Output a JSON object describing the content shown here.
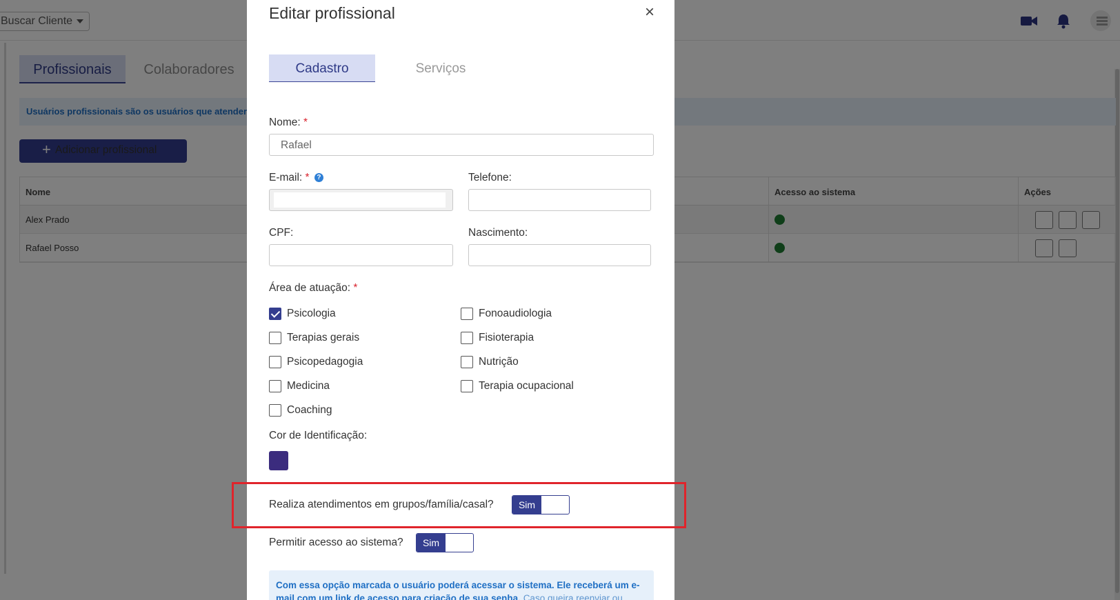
{
  "topbar": {
    "search_client_label": "Buscar Cliente"
  },
  "background": {
    "tabs": [
      "Profissionais",
      "Colaboradores"
    ],
    "info_text": "Usuários profissionais são os usuários que atender",
    "add_button_label": "Adicionar profissional",
    "table": {
      "headers": [
        "Nome",
        "Acesso ao sistema",
        "Ações"
      ],
      "rows": [
        {
          "name": "Alex Prado"
        },
        {
          "name": "Rafael Posso"
        }
      ]
    }
  },
  "modal": {
    "title": "Editar profissional",
    "close_symbol": "×",
    "tabs": [
      "Cadastro",
      "Serviços"
    ],
    "fields": {
      "nome_label": "Nome:",
      "nome_value": "Rafael",
      "email_label": "E-mail:",
      "telefone_label": "Telefone:",
      "cpf_label": "CPF:",
      "nascimento_label": "Nascimento:",
      "required_mark": "*",
      "help_mark": "?"
    },
    "area_label": "Área de atuação:",
    "areas": [
      {
        "label": "Psicologia",
        "checked": true
      },
      {
        "label": "Fonoaudiologia",
        "checked": false
      },
      {
        "label": "Terapias gerais",
        "checked": false
      },
      {
        "label": "Fisioterapia",
        "checked": false
      },
      {
        "label": "Psicopedagogia",
        "checked": false
      },
      {
        "label": "Nutrição",
        "checked": false
      },
      {
        "label": "Medicina",
        "checked": false
      },
      {
        "label": "Terapia ocupacional",
        "checked": false
      },
      {
        "label": "Coaching",
        "checked": false
      }
    ],
    "color_label": "Cor de Identificação:",
    "color_value": "#3b2c7e",
    "group_question": "Realiza atendimentos em grupos/família/casal?",
    "group_toggle": "Sim",
    "access_question": "Permitir acesso ao sistema?",
    "access_toggle": "Sim",
    "info_bold": "Com essa opção marcada o usuário poderá acessar o sistema. Ele receberá um e-mail com um link de acesso para criação de sua senha.",
    "info_light": "Caso queira reenviar ou"
  },
  "colors": {
    "accent": "#343e8f",
    "highlight": "#e0242b",
    "info": "#1f6fc4"
  }
}
